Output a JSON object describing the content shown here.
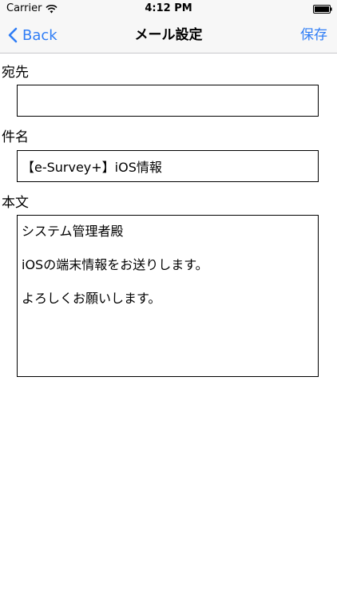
{
  "status_bar": {
    "carrier": "Carrier",
    "time": "4:12 PM",
    "wifi_icon": "wifi-icon",
    "battery_icon": "battery-icon"
  },
  "nav_bar": {
    "back_label": "Back",
    "back_icon": "chevron-left-icon",
    "title": "メール設定",
    "save_label": "保存"
  },
  "form": {
    "to": {
      "label": "宛先",
      "value": ""
    },
    "subject": {
      "label": "件名",
      "value": "【e-Survey+】iOS情報"
    },
    "body": {
      "label": "本文",
      "lines": [
        "システム管理者殿",
        "iOSの端末情報をお送りします。",
        "よろしくお願いします。"
      ]
    }
  },
  "colors": {
    "accent": "#2f7df6",
    "bar_background": "#f7f7f7",
    "border": "#000000"
  }
}
